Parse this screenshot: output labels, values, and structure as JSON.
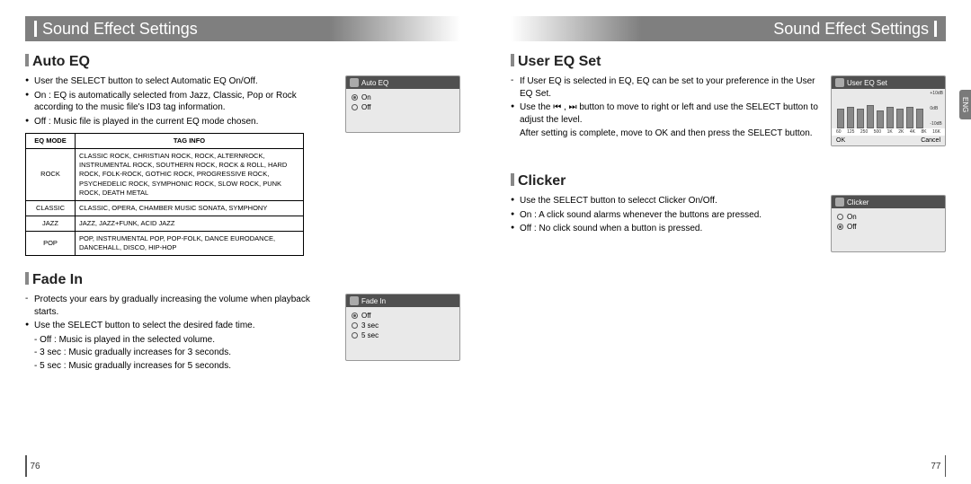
{
  "header": {
    "title": "Sound Effect Settings"
  },
  "pageNumbers": {
    "left": "76",
    "right": "77"
  },
  "sideTab": {
    "active": "ENG"
  },
  "left": {
    "autoEQ": {
      "title": "Auto EQ",
      "b1": "User the SELECT button to select Automatic EQ On/Off.",
      "b2": "On : EQ is automatically selected from Jazz, Classic, Pop or Rock according to the music file's ID3 tag information.",
      "b3": "Off : Music file is played in the current EQ mode chosen.",
      "table": {
        "h1": "EQ MODE",
        "h2": "TAG INFO",
        "rows": [
          {
            "mode": "ROCK",
            "info": "CLASSIC ROCK, CHRISTIAN ROCK, ROCK, ALTERNROCK, INSTRUMENTAL ROCK, SOUTHERN ROCK, ROCK & ROLL, HARD ROCK, FOLK-ROCK, GOTHIC ROCK, PROGRESSIVE ROCK, PSYCHEDELIC ROCK, SYMPHONIC ROCK, SLOW ROCK, PUNK ROCK, DEATH METAL"
          },
          {
            "mode": "CLASSIC",
            "info": "CLASSIC, OPERA, CHAMBER MUSIC SONATA, SYMPHONY"
          },
          {
            "mode": "JAZZ",
            "info": "JAZZ, JAZZ+FUNK, ACID JAZZ"
          },
          {
            "mode": "POP",
            "info": "POP, INSTRUMENTAL POP, POP-FOLK, DANCE EURODANCE, DANCEHALL, DISCO, HIP-HOP"
          }
        ]
      },
      "screen": {
        "title": "Auto EQ",
        "opt1": "On",
        "opt2": "Off"
      }
    },
    "fadeIn": {
      "title": "Fade In",
      "lead": "Protects your ears by gradually increasing the volume when playback starts.",
      "b1": "Use the SELECT button to select the desired fade time.",
      "s1": "- Off : Music is played in the selected volume.",
      "s2": "- 3 sec : Music gradually increases for 3 seconds.",
      "s3": "- 5 sec : Music gradually increases for 5 seconds.",
      "screen": {
        "title": "Fade In",
        "opt1": "Off",
        "opt2": "3 sec",
        "opt3": "5 sec"
      }
    }
  },
  "right": {
    "userEQ": {
      "title": "User EQ Set",
      "lead": "If User EQ is selected in EQ, EQ can be set to your preference in the User EQ Set.",
      "b1": "Use the ⏮ , ⏭ button to move to right or left and use the SELECT button to adjust the level.",
      "b1_cont": "After setting is complete, move to OK and then press the SELECT button.",
      "screen": {
        "title": "User EQ Set",
        "scale": {
          "top": "+10dB",
          "mid": "0dB",
          "bot": "-10dB"
        },
        "freqs": [
          "60",
          "125",
          "250",
          "500",
          "1K",
          "2K",
          "4K",
          "8K",
          "16K"
        ],
        "ok": "OK",
        "cancel": "Cancel"
      }
    },
    "clicker": {
      "title": "Clicker",
      "b1": "Use the SELECT button to selecct Clicker On/Off.",
      "b2": "On : A click sound alarms whenever the buttons are pressed.",
      "b3": "Off : No click sound when a button is pressed.",
      "screen": {
        "title": "Clicker",
        "opt1": "On",
        "opt2": "Off"
      }
    }
  },
  "chart_data": {
    "type": "bar",
    "title": "User EQ Set",
    "categories": [
      "60",
      "125",
      "250",
      "500",
      "1K",
      "2K",
      "4K",
      "8K",
      "16K"
    ],
    "values": [
      5,
      6,
      5,
      7,
      4,
      6,
      5,
      6,
      5
    ],
    "ylabel": "dB",
    "ylim": [
      -10,
      10
    ]
  }
}
